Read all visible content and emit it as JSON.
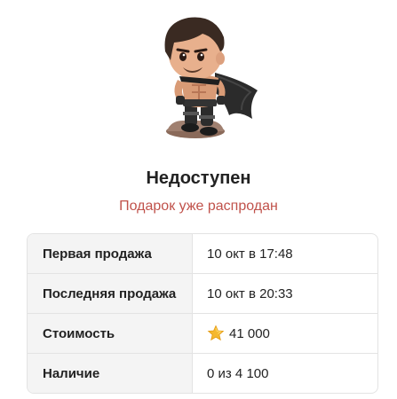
{
  "gift": {
    "image_icon": "hero-figurine-icon",
    "status_title": "Недоступен",
    "status_subtitle": "Подарок уже распродан",
    "subtitle_color": "#c0524b"
  },
  "details": {
    "rows": [
      {
        "label": "Первая продажа",
        "value": "10 окт в 17:48"
      },
      {
        "label": "Последняя продажа",
        "value": "10 окт в 20:33"
      },
      {
        "label": "Стоимость",
        "value": "41 000",
        "icon": "star-icon"
      },
      {
        "label": "Наличие",
        "value": "0 из 4 100"
      }
    ]
  }
}
